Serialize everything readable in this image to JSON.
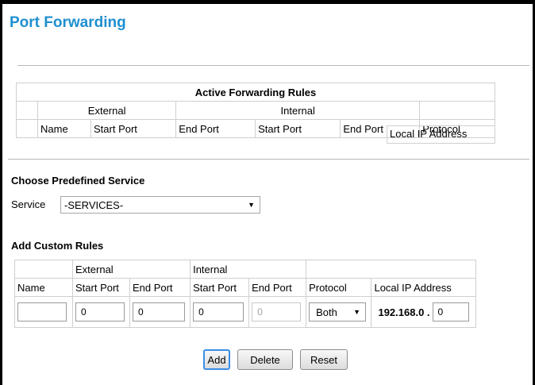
{
  "page": {
    "title": "Port Forwarding"
  },
  "active_rules": {
    "title": "Active Forwarding Rules",
    "group_external": "External",
    "group_internal": "Internal",
    "columns": [
      "Name",
      "Start Port",
      "End Port",
      "Start Port",
      "End Port",
      "Protocol",
      "Local IP Address"
    ]
  },
  "predefined": {
    "title": "Choose Predefined Service",
    "label": "Service",
    "selected": "-SERVICES-"
  },
  "custom": {
    "title": "Add Custom Rules",
    "group_external": "External",
    "group_internal": "Internal",
    "columns": [
      "Name",
      "Start Port",
      "End Port",
      "Start Port",
      "End Port",
      "Protocol",
      "Local IP Address"
    ],
    "values": {
      "name": "",
      "ext_start": "0",
      "ext_end": "0",
      "int_start": "0",
      "int_end": "0",
      "protocol": "Both",
      "ip_prefix": "192.168.0 .",
      "ip_last": "0"
    }
  },
  "buttons": {
    "add": "Add",
    "delete": "Delete",
    "reset": "Reset"
  },
  "colors": {
    "title": "#1e8fcf",
    "focus_border": "#3a8ee6"
  },
  "icons": {
    "dropdown": "chevron-down-icon"
  }
}
